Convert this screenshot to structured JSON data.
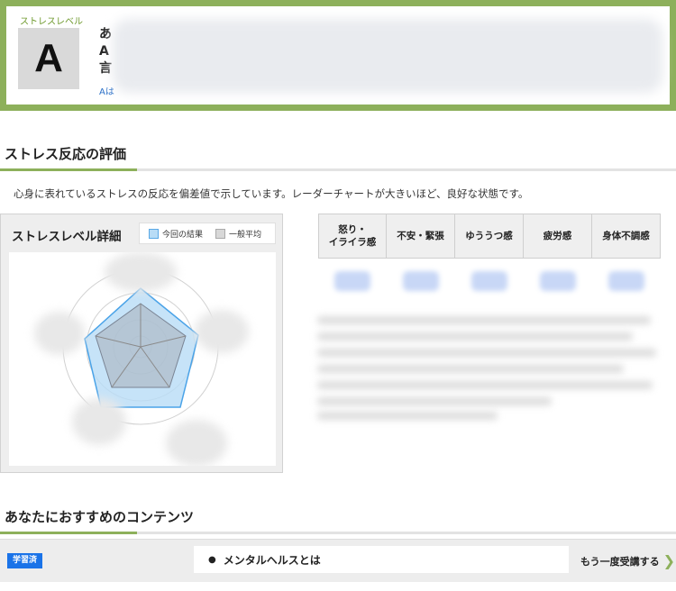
{
  "stress_level": {
    "caption": "ストレスレベル",
    "grade": "A",
    "text_line1": "あ",
    "text_line2": "A",
    "text_line3": "言",
    "link_prefix": "Aは"
  },
  "evaluation": {
    "title": "ストレス反応の評価",
    "intro": "心身に表れているストレスの反応を偏差値で示しています。レーダーチャートが大きいほど、良好な状態です。"
  },
  "radar": {
    "title": "ストレスレベル詳細",
    "legend_current": "今回の結果",
    "legend_average": "一般平均",
    "colors": {
      "current_fill": "#b8dcf6",
      "current_stroke": "#4aa3e8",
      "average_fill": "#a8aeb8",
      "grid": "#c8c8c8"
    }
  },
  "scores": {
    "headers": [
      "怒り・\nイライラ感",
      "不安・緊張",
      "ゆううつ感",
      "疲労感",
      "身体不調感"
    ]
  },
  "recommend": {
    "title": "あなたにおすすめのコンテンツ",
    "badge": "学習済",
    "item": "メンタルヘルスとは",
    "retake": "もう一度受講する",
    "retake_icon": "chevron-right-icon"
  }
}
